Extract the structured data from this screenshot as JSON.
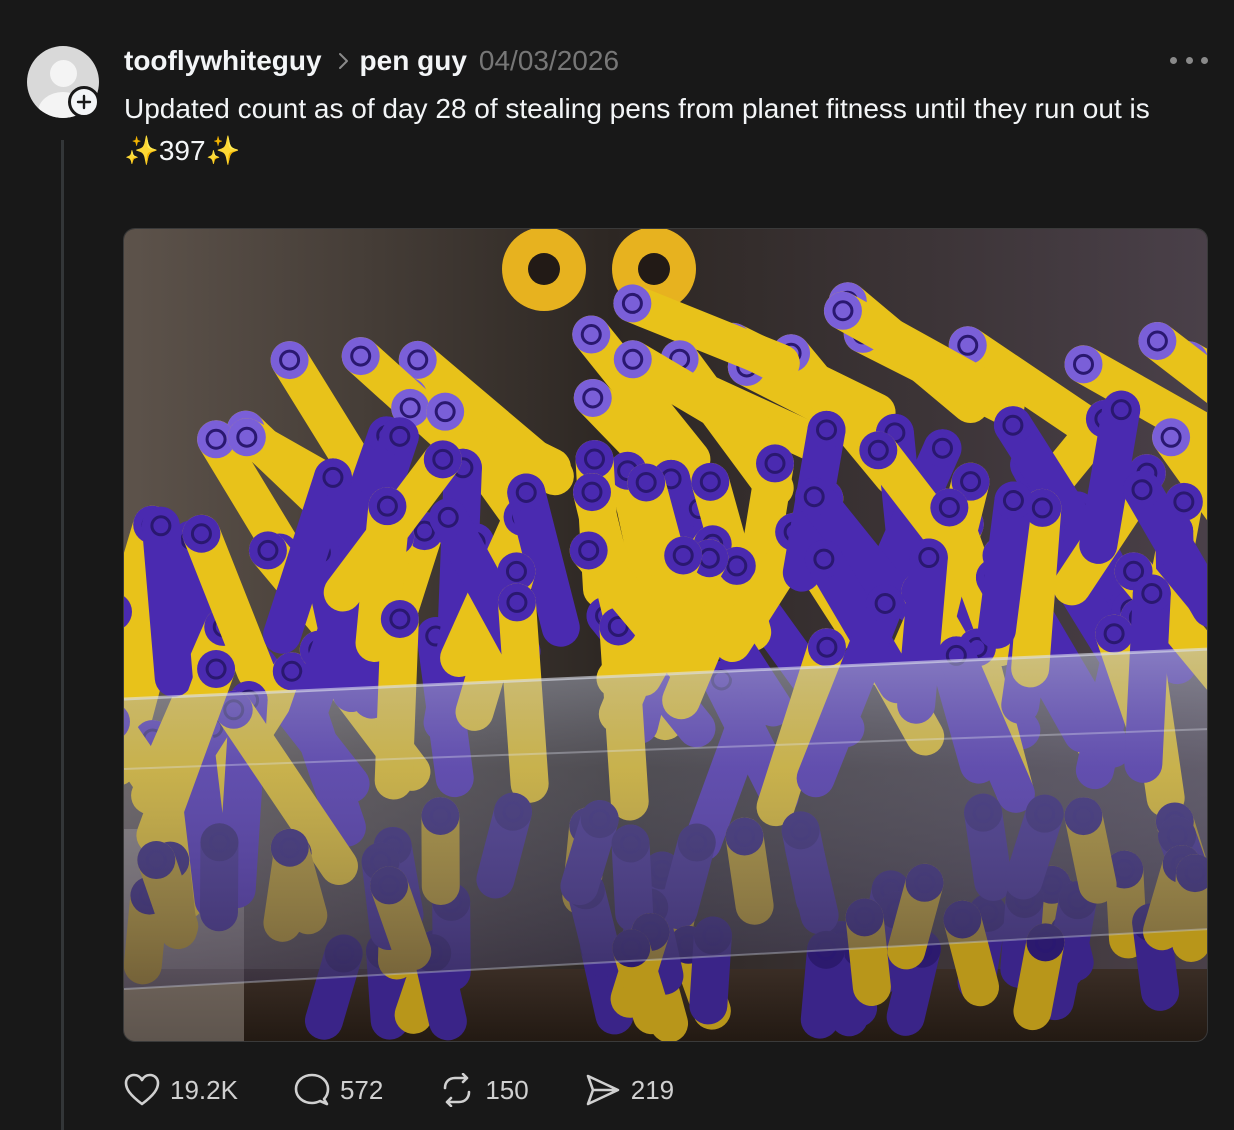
{
  "post": {
    "author": "tooflywhiteguy",
    "topic": "pen guy",
    "date": "04/03/2026",
    "text_line1": "Updated count as of day 28 of stealing pens from planet fitness until they run out is",
    "text_line2": "✨397✨"
  },
  "actions": {
    "likes": "19.2K",
    "replies": "572",
    "reposts": "150",
    "shares": "219"
  },
  "icons": {
    "avatar": "default-avatar-icon",
    "follow": "plus-icon",
    "chevron": "chevron-right-icon",
    "more": "more-dots-icon",
    "like": "heart-icon",
    "reply": "comment-bubble-icon",
    "repost": "repost-icon",
    "share": "share-send-icon"
  },
  "colors": {
    "background": "#181818",
    "text": "#f3f5f7",
    "muted": "#777777",
    "pen_purple": "#4a2ab0",
    "pen_yellow": "#e8c21a"
  }
}
